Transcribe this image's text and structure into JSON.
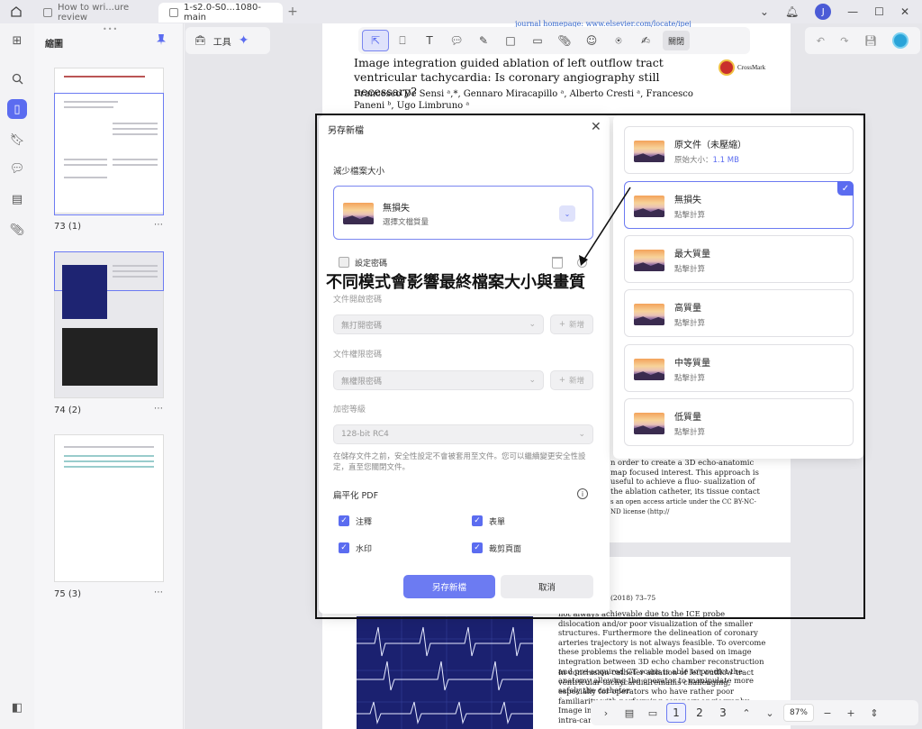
{
  "tabs": [
    {
      "label": "How to wri...ure review"
    },
    {
      "label": "1-s2.0-S0...1080-main"
    }
  ],
  "user_initial": "J",
  "thumb_panel": {
    "title": "縮圖",
    "pages": [
      {
        "label": "73 (1)"
      },
      {
        "label": "74 (2)"
      },
      {
        "label": "75 (3)"
      }
    ]
  },
  "toolbar": {
    "tools_label": "工具",
    "close_label": "關閉"
  },
  "paper": {
    "journal_line": "journal homepage: www.elsevier.com/locate/ipej",
    "title": "Image integration guided ablation of left outflow tract ventricular tachycardia: Is coronary angiography still necessary?",
    "authors": "Francesco De Sensi ᵃ,*, Gennaro Miracapillo ᵃ, Alberto Cresti ᵃ, Francesco Paneni ᵇ, Ugo Limbruno ᵃ",
    "crossmark": "CrossMark",
    "para1": "n order to create a 3D echo-anatomic map focused interest. This approach is useful to achieve a fluo- sualization of the ablation catheter, its tissue contact",
    "para2": "s an open access article under the CC BY-NC-ND license (http://",
    "citation": "(2018) 73–75",
    "para3": "not always achievable due to the ICE probe dislocation and/or poor visualization of the smaller structures. Furthermore the delineation of coronary arteries trajectory is not always feasible. To overcome these problems the reliable model based on image integration between 3D echo chamber reconstruction and pre-acquired CT scans is able to predict the anatomy allowing the operator to manipulate more safely the catheter.",
    "para4": "In conclusion catheter ablation of left outflow tract ventricular tachycardia remains challenging, especially for operators who have rather poor familiarity with performing coronary angiography. Image integration between pre-acquired CT scans and intra-cardiac echo reco localiz the effica"
  },
  "dialog": {
    "title": "另存新檔",
    "reduce_size_label": "減少檔案大小",
    "selected_quality": {
      "name": "無損失",
      "sub": "選擇文檔質量"
    },
    "set_password_label": "設定密碼",
    "open_password_label": "文件開啟密碼",
    "open_password_value": "無打開密碼",
    "add_label": "新增",
    "permission_password_label": "文件權限密碼",
    "permission_password_value": "無權限密碼",
    "encryption_label": "加密等級",
    "encryption_value": "128-bit RC4",
    "note": "在儲存文件之前，安全性設定不會被套用至文件。您可以繼續變更安全性設定，直至您關閉文件。",
    "flatten_label": "扁平化 PDF",
    "flatten_options": [
      {
        "label": "注釋",
        "checked": true
      },
      {
        "label": "表單",
        "checked": true
      },
      {
        "label": "水印",
        "checked": true
      },
      {
        "label": "裁剪頁面",
        "checked": true
      }
    ],
    "save_button": "另存新檔",
    "cancel_button": "取消"
  },
  "quality_options": [
    {
      "name": "原文件（未壓縮）",
      "sub": "原始大小：",
      "size": "1.1 MB",
      "selected": false
    },
    {
      "name": "無損失",
      "sub": "點擊計算",
      "selected": true
    },
    {
      "name": "最大質量",
      "sub": "點擊計算",
      "selected": false
    },
    {
      "name": "高質量",
      "sub": "點擊計算",
      "selected": false
    },
    {
      "name": "中等質量",
      "sub": "點擊計算",
      "selected": false
    },
    {
      "name": "低質量",
      "sub": "點擊計算",
      "selected": false
    }
  ],
  "annotation": "不同模式會影響最終檔案大小與畫質",
  "bottom_bar": {
    "pages": [
      "1",
      "2",
      "3"
    ],
    "zoom": "87%"
  },
  "colors": {
    "accent": "#5b6cf0",
    "selected_border": "#6c7bf2"
  }
}
